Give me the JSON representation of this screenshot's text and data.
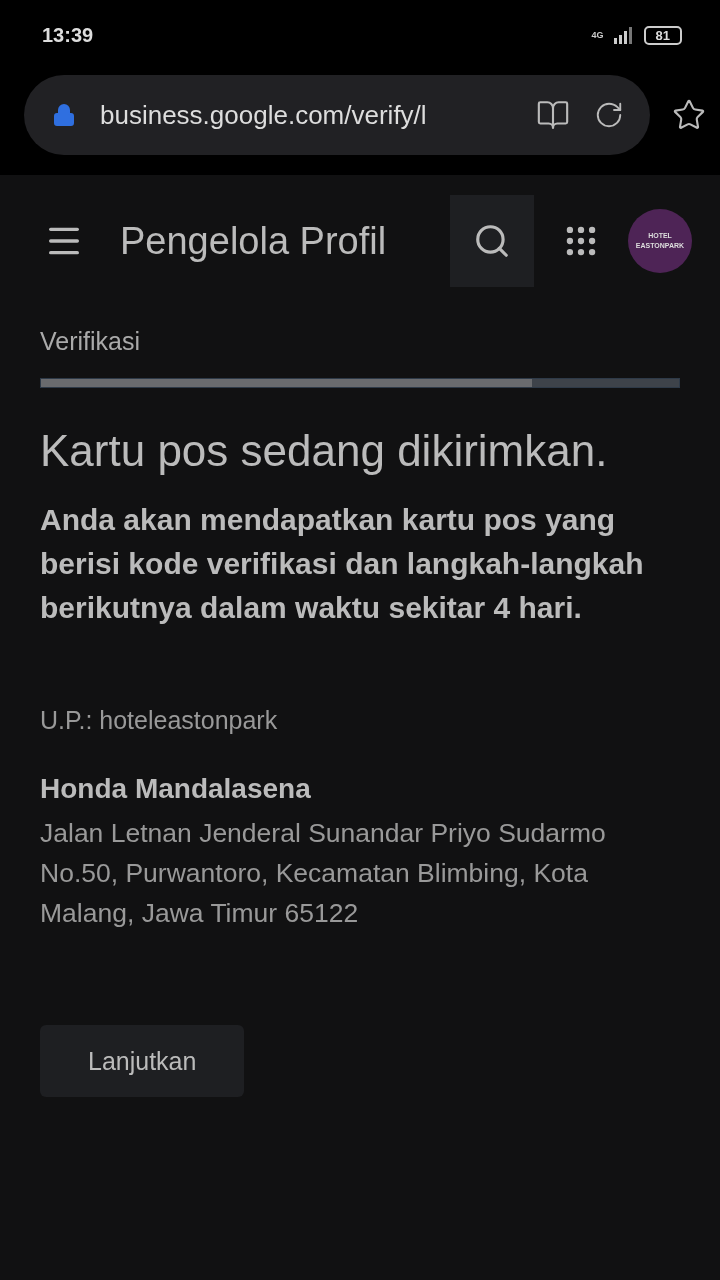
{
  "status_bar": {
    "time": "13:39",
    "network": "4G",
    "battery": "81"
  },
  "browser": {
    "url": "business.google.com/verify/l"
  },
  "app_bar": {
    "title": "Pengelola Profil",
    "avatar": {
      "line1": "HOTEL",
      "line2": "EASTONPARK"
    }
  },
  "step": {
    "label": "Verifikasi",
    "level": 0.77
  },
  "heading": "Kartu pos sedang dikirimkan.",
  "subheading": "Anda akan mendapatkan kartu pos yang berisi kode verifikasi dan langkah-langkah berikutnya dalam waktu sekitar 4 hari.",
  "recipient": "U.P.: hoteleastonpark",
  "business": {
    "name": "Honda Mandalasena",
    "address": "Jalan Letnan Jenderal Sunandar Priyo Sudarmo No.50, Purwantoro, Kecamatan Blimbing, Kota Malang, Jawa Timur 65122"
  },
  "buttons": [
    "Lanjutkan"
  ]
}
